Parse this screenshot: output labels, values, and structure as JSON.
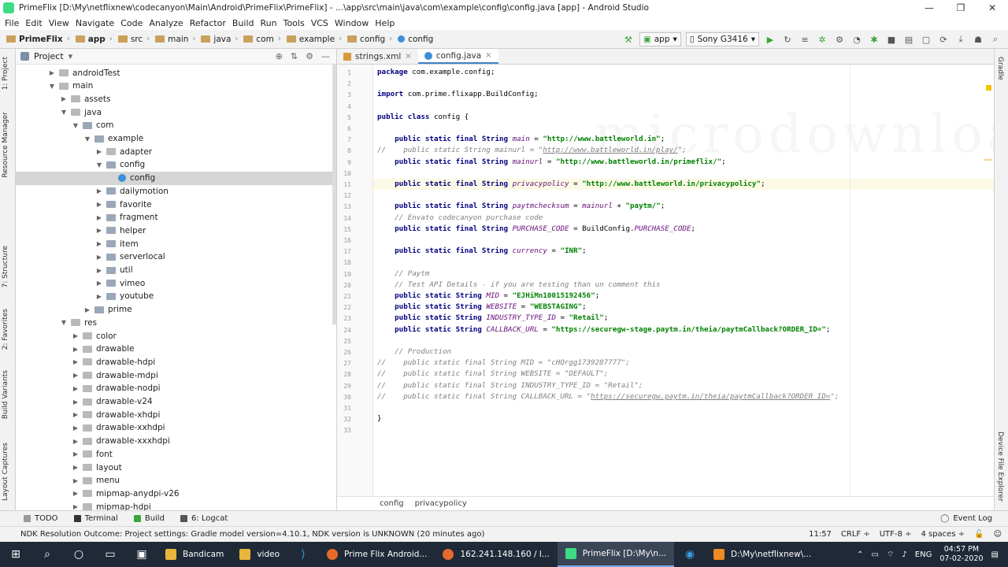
{
  "window": {
    "title": "PrimeFlix [D:\\My\\netflixnew\\codecanyon\\Main\\Android\\PrimeFlix\\PrimeFlix] - ...\\app\\src\\main\\java\\com\\example\\config\\config.java [app] - Android Studio",
    "controls": [
      "—",
      "❐",
      "✕"
    ]
  },
  "menu": [
    "File",
    "Edit",
    "View",
    "Navigate",
    "Code",
    "Analyze",
    "Refactor",
    "Build",
    "Run",
    "Tools",
    "VCS",
    "Window",
    "Help"
  ],
  "breadcrumbs": [
    "PrimeFlix",
    "app",
    "src",
    "main",
    "java",
    "com",
    "example",
    "config",
    "config"
  ],
  "toolbar": {
    "run_config": "app",
    "device": "Sony G3416"
  },
  "project_panel": {
    "title": "Project",
    "tree": [
      {
        "label": "androidTest",
        "arrow": "▶"
      },
      {
        "label": "main",
        "arrow": "▼"
      },
      {
        "label": "assets",
        "arrow": "▶"
      },
      {
        "label": "java",
        "arrow": "▼"
      },
      {
        "label": "com",
        "arrow": "▼"
      },
      {
        "label": "example",
        "arrow": "▼"
      },
      {
        "label": "adapter",
        "arrow": "▶"
      },
      {
        "label": "config",
        "arrow": "▼"
      },
      {
        "label": "config",
        "arrow": ""
      },
      {
        "label": "dailymotion",
        "arrow": "▶"
      },
      {
        "label": "favorite",
        "arrow": "▶"
      },
      {
        "label": "fragment",
        "arrow": "▶"
      },
      {
        "label": "helper",
        "arrow": "▶"
      },
      {
        "label": "item",
        "arrow": "▶"
      },
      {
        "label": "serverlocal",
        "arrow": "▶"
      },
      {
        "label": "util",
        "arrow": "▶"
      },
      {
        "label": "vimeo",
        "arrow": "▶"
      },
      {
        "label": "youtube",
        "arrow": "▶"
      },
      {
        "label": "prime",
        "arrow": "▶"
      },
      {
        "label": "res",
        "arrow": "▼"
      },
      {
        "label": "color",
        "arrow": "▶"
      },
      {
        "label": "drawable",
        "arrow": "▶"
      },
      {
        "label": "drawable-hdpi",
        "arrow": "▶"
      },
      {
        "label": "drawable-mdpi",
        "arrow": "▶"
      },
      {
        "label": "drawable-nodpi",
        "arrow": "▶"
      },
      {
        "label": "drawable-v24",
        "arrow": "▶"
      },
      {
        "label": "drawable-xhdpi",
        "arrow": "▶"
      },
      {
        "label": "drawable-xxhdpi",
        "arrow": "▶"
      },
      {
        "label": "drawable-xxxhdpi",
        "arrow": "▶"
      },
      {
        "label": "font",
        "arrow": "▶"
      },
      {
        "label": "layout",
        "arrow": "▶"
      },
      {
        "label": "menu",
        "arrow": "▶"
      },
      {
        "label": "mipmap-anydpi-v26",
        "arrow": "▶"
      },
      {
        "label": "mipmap-hdpi",
        "arrow": "▶"
      }
    ]
  },
  "editor": {
    "tabs": [
      "strings.xml",
      "config.java"
    ],
    "active_tab": "config.java",
    "watermark": "microdownload.net",
    "breadcrumb": [
      "config",
      "privacypolicy"
    ],
    "lines": [
      "package com.example.config;",
      "",
      "import com.prime.flixapp.BuildConfig;",
      "",
      "public class config {",
      "",
      "    public static final String main = \"http://www.battleworld.in\";",
      "//    public static String mainurl = \"http://www.battleworld.in/play/\";",
      "    public static final String mainurl = \"http://www.battleworld.in/primeflix/\";",
      "",
      "    public static final String privacypolicy = \"http://www.battleworld.in/privacypolicy\";",
      "",
      "    public static final String paytmchecksum = mainurl + \"paytm/\";",
      "    // Envato codecanyon purchase code",
      "    public static final String PURCHASE_CODE = BuildConfig.PURCHASE_CODE;",
      "",
      "    public static final String currency = \"INR\";",
      "",
      "    // Paytm",
      "    // Test API Details - if you are testing than un comment this",
      "    public static String MID = \"EJHiMn10015192456\";",
      "    public static String WEBSITE = \"WEBSTAGING\";",
      "    public static String INDUSTRY_TYPE_ID = \"Retail\";",
      "    public static String CALLBACK_URL = \"https://securegw-stage.paytm.in/theia/paytmCallback?ORDER_ID=\";",
      "",
      "    // Production",
      "//    public static final String MID = \"cHQrgg1739287777\";",
      "//    public static final String WEBSITE = \"DEFAULT\";",
      "//    public static final String INDUSTRY_TYPE_ID = \"Retail\";",
      "//    public static final String CALLBACK_URL = \"https://securegw.paytm.in/theia/paytmCallback?ORDER_ID=\";",
      "",
      "}",
      ""
    ]
  },
  "left_strip": [
    "1: Project",
    "Resource Manager",
    "7: Structure",
    "2: Favorites",
    "Build Variants",
    "Layout Captures"
  ],
  "right_strip": [
    "Gradle",
    "Device File Explorer"
  ],
  "bottom_tools": [
    "TODO",
    "Terminal",
    "Build",
    "6: Logcat"
  ],
  "event_log": "Event Log",
  "status": {
    "message": "NDK Resolution Outcome: Project settings: Gradle model version=4.10.1, NDK version is UNKNOWN (20 minutes ago)",
    "position": "11:57",
    "line_sep": "CRLF ÷",
    "encoding": "UTF-8 ÷",
    "indent": "4 spaces ÷"
  },
  "taskbar": {
    "apps": [
      "Bandicam",
      "video",
      "Prime Flix Android...",
      "162.241.148.160 / l...",
      "PrimeFlix [D:\\My\\n...",
      "D:\\My\\netflixnew\\..."
    ],
    "lang": "ENG",
    "time": "04:57 PM",
    "date": "07-02-2020"
  }
}
